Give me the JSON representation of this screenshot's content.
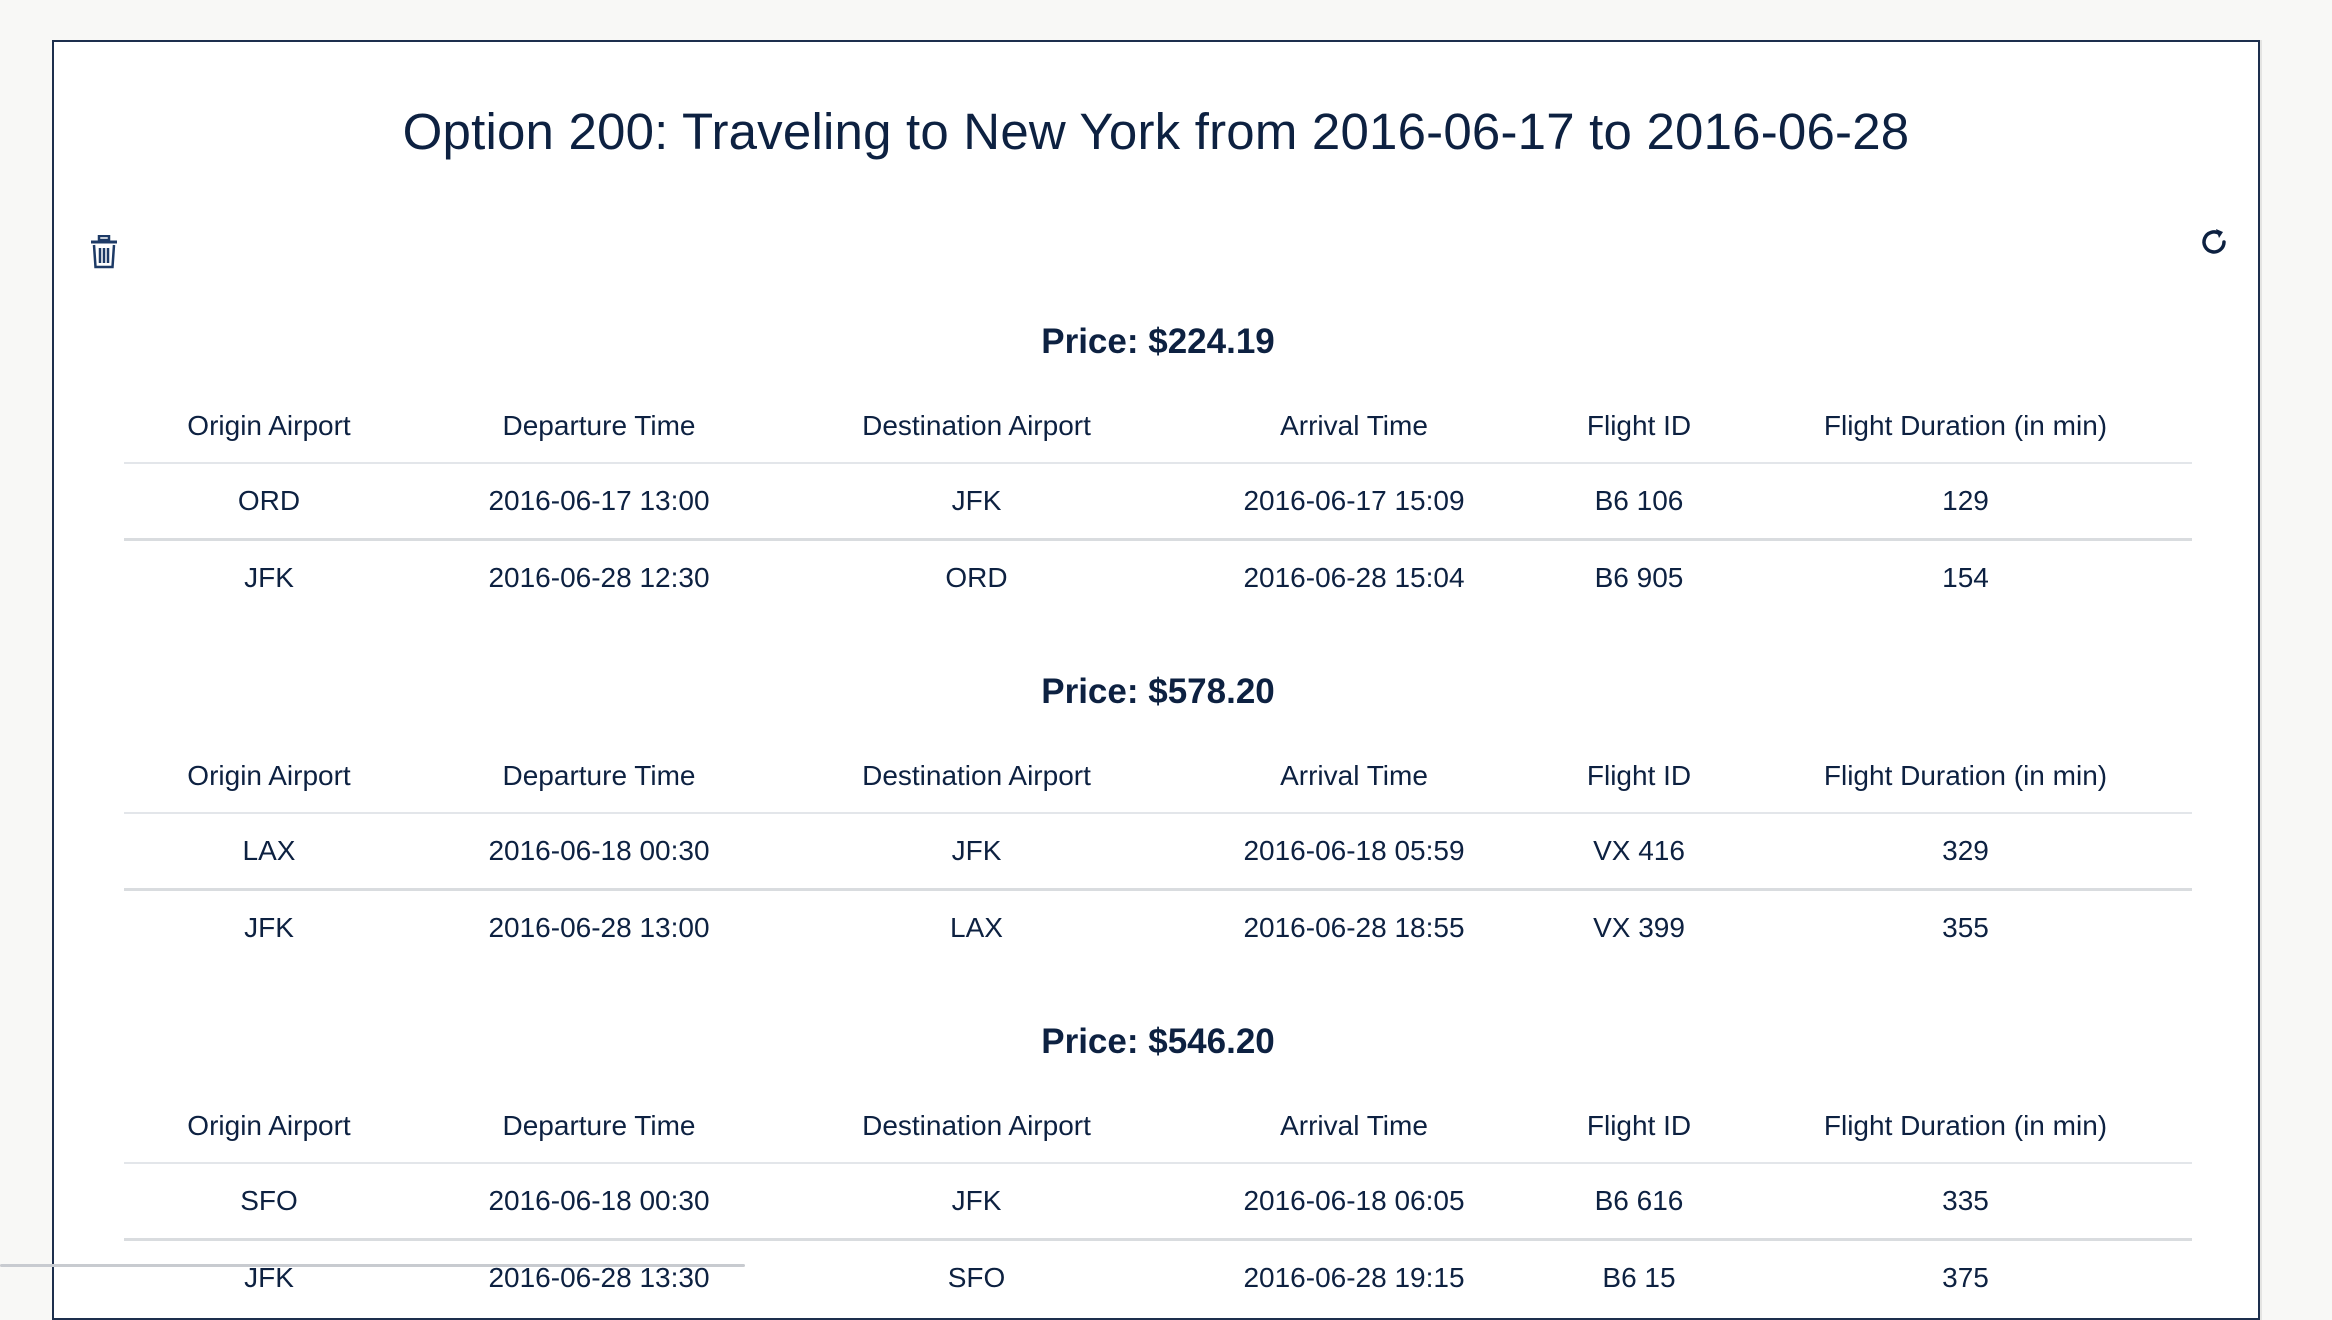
{
  "page": {
    "title": "Option 200: Traveling to New York from 2016-06-17 to 2016-06-28"
  },
  "icons": {
    "delete": "trash-icon",
    "refresh": "refresh-icon"
  },
  "table_headers": [
    "Origin Airport",
    "Departure Time",
    "Destination Airport",
    "Arrival Time",
    "Flight ID",
    "Flight Duration (in min)"
  ],
  "options": [
    {
      "price": "Price: $224.19",
      "rows": [
        [
          "ORD",
          "2016-06-17 13:00",
          "JFK",
          "2016-06-17 15:09",
          "B6 106",
          "129"
        ],
        [
          "JFK",
          "2016-06-28 12:30",
          "ORD",
          "2016-06-28 15:04",
          "B6 905",
          "154"
        ]
      ]
    },
    {
      "price": "Price: $578.20",
      "rows": [
        [
          "LAX",
          "2016-06-18 00:30",
          "JFK",
          "2016-06-18 05:59",
          "VX 416",
          "329"
        ],
        [
          "JFK",
          "2016-06-28 13:00",
          "LAX",
          "2016-06-28 18:55",
          "VX 399",
          "355"
        ]
      ]
    },
    {
      "price": "Price: $546.20",
      "rows": [
        [
          "SFO",
          "2016-06-18 00:30",
          "JFK",
          "2016-06-18 06:05",
          "B6 616",
          "335"
        ],
        [
          "JFK",
          "2016-06-28 13:30",
          "SFO",
          "2016-06-28 19:15",
          "B6 15",
          "375"
        ]
      ]
    }
  ],
  "colors": {
    "text": "#0d2141",
    "border": "#1d2f4d",
    "background": "#f8f8f6",
    "card": "#ffffff"
  }
}
